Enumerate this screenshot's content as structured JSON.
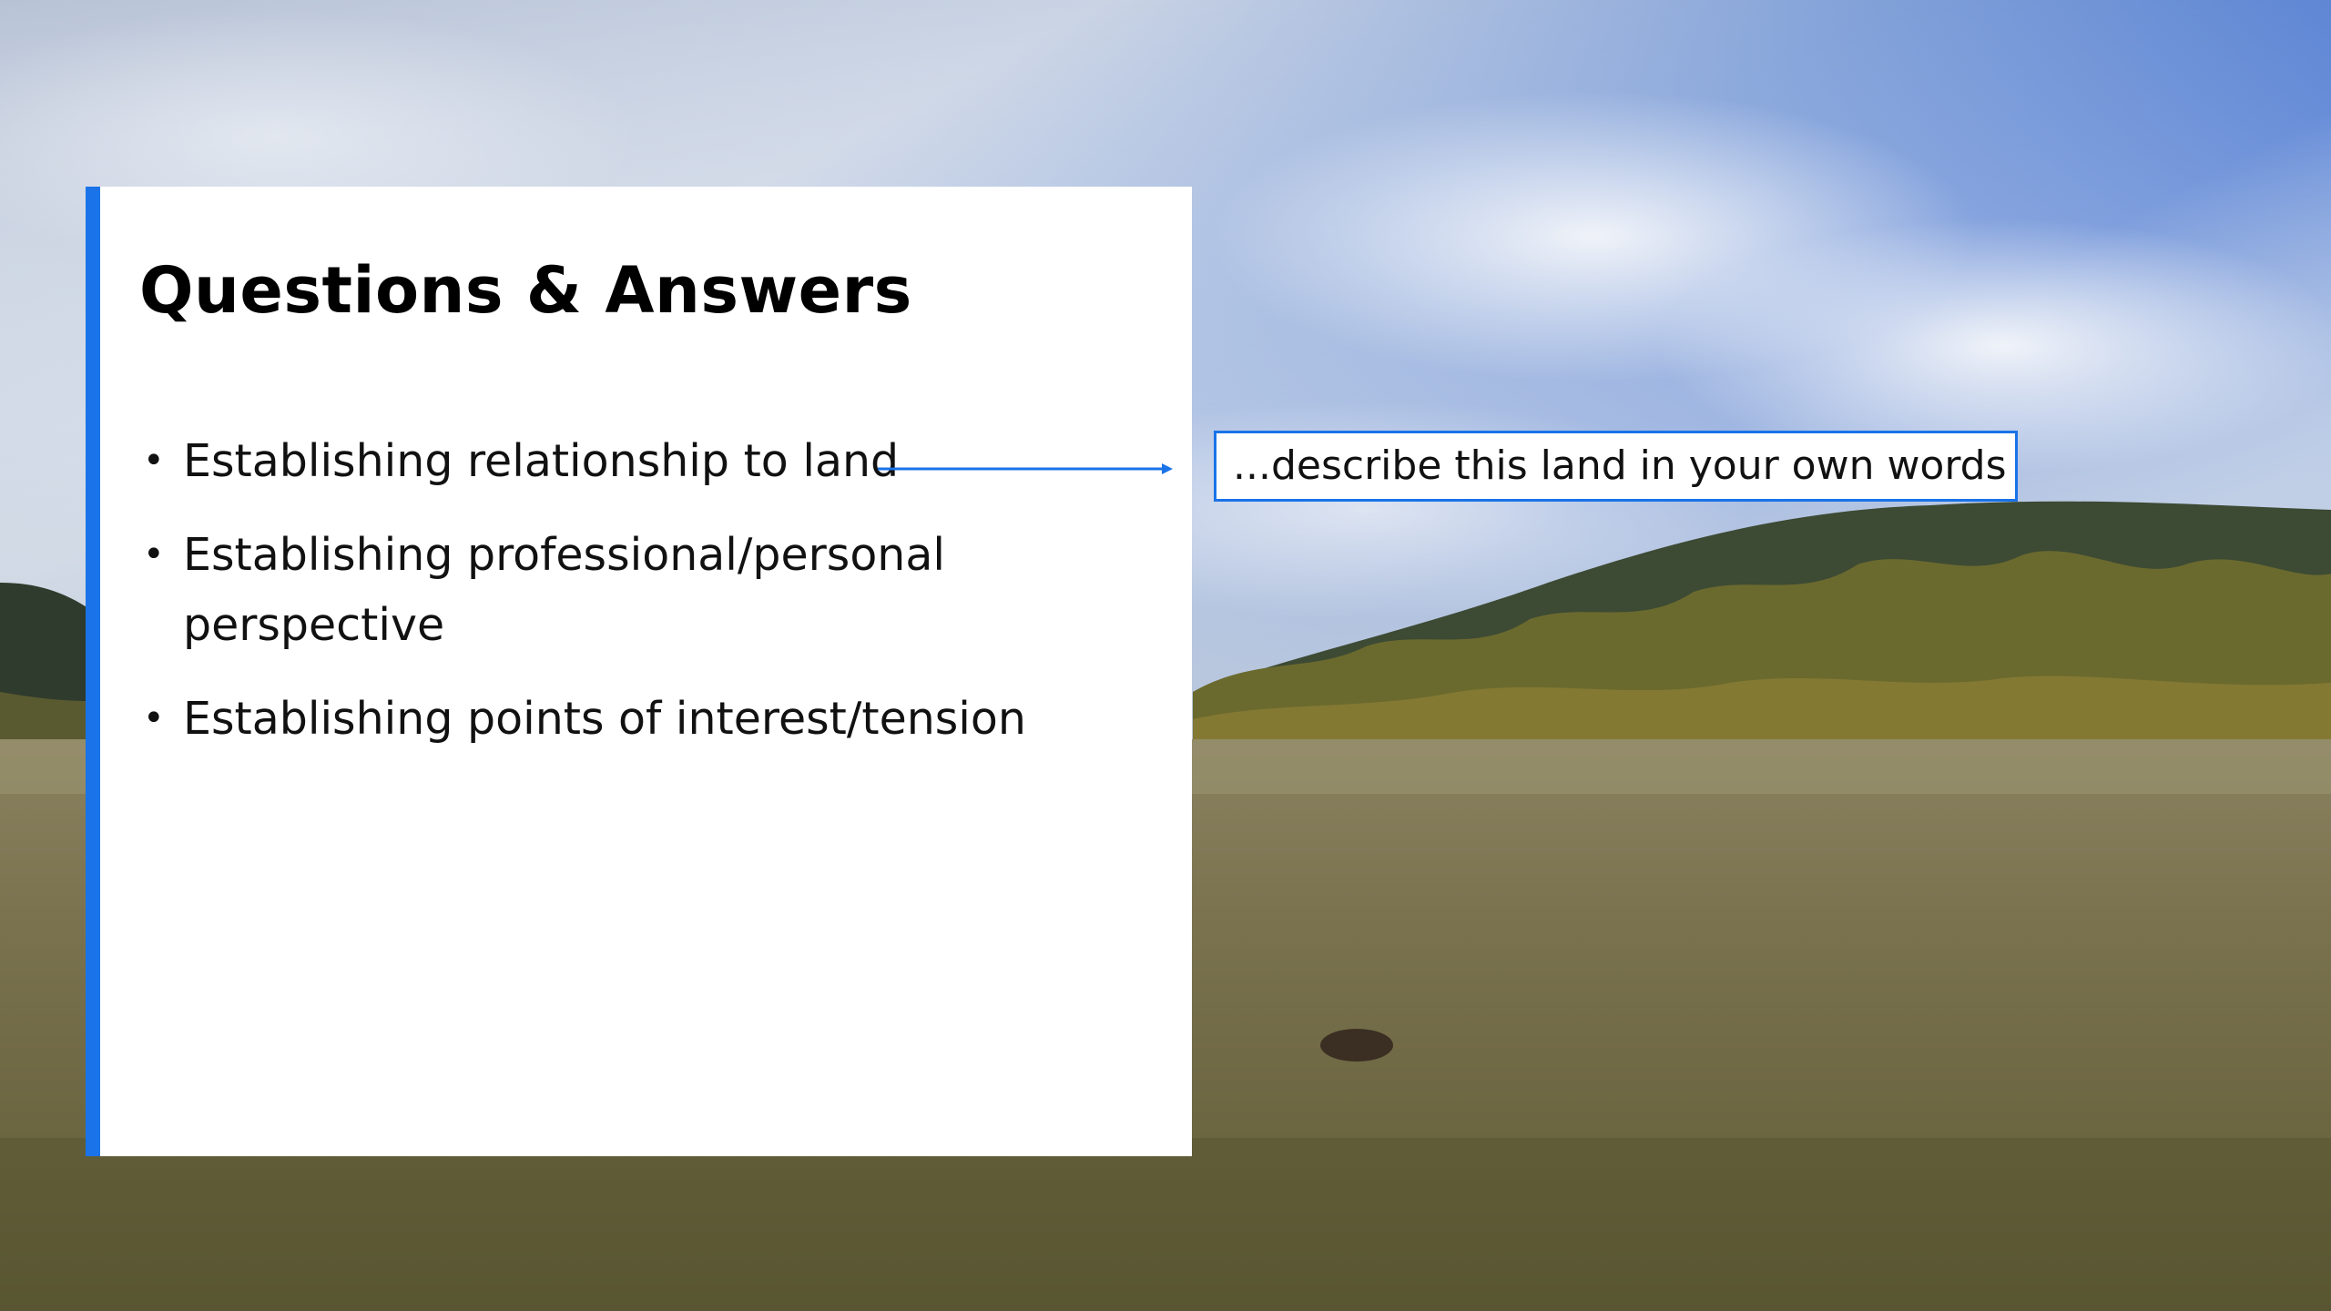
{
  "slide": {
    "title": "Questions & Answers",
    "bullets": [
      "Establishing relationship to land",
      "Establishing professional/personal perspective",
      "Establishing points of interest/tension"
    ],
    "callout": "...describe this land in your own words"
  },
  "colors": {
    "accent": "#1a73e8",
    "panel": "#ffffff",
    "text": "#111111"
  },
  "background": {
    "subject": "field-and-hills-photo"
  }
}
